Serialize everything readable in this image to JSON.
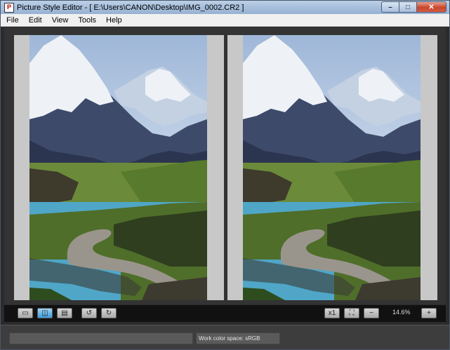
{
  "window": {
    "title": "Picture Style Editor - [ E:\\Users\\CANON\\Desktop\\IMG_0002.CR2 ]",
    "app_icon_glyph": "P",
    "controls": {
      "minimize": "–",
      "maximize": "□",
      "close": "✕"
    }
  },
  "menu": {
    "items": [
      {
        "label": "File"
      },
      {
        "label": "Edit"
      },
      {
        "label": "View"
      },
      {
        "label": "Tools"
      },
      {
        "label": "Help"
      }
    ]
  },
  "toolbar": {
    "left_buttons": [
      {
        "icon": "single-view-icon",
        "glyph": "▭",
        "active": false
      },
      {
        "icon": "split-view-icon",
        "glyph": "◫",
        "active": true
      },
      {
        "icon": "horizontal-split-icon",
        "glyph": "▤",
        "active": false
      },
      {
        "icon": "rotate-left-icon",
        "glyph": "↺",
        "active": false
      },
      {
        "icon": "rotate-right-icon",
        "glyph": "↻",
        "active": false
      }
    ],
    "right_buttons": [
      {
        "icon": "actual-size-icon",
        "glyph": "x1"
      },
      {
        "icon": "fit-to-window-icon",
        "glyph": "⛶"
      },
      {
        "icon": "zoom-out-icon",
        "glyph": "−"
      },
      {
        "icon": "zoom-in-icon",
        "glyph": "+"
      }
    ],
    "zoom_level": "14.6%"
  },
  "status": {
    "left_text": "",
    "color_space": "Work color space: sRGB"
  },
  "colors": {
    "sky": "#b9cde5",
    "snow": "#eef2f7",
    "rock": "#3d4a6a",
    "grass": "#6b8a3a",
    "water": "#4fa6c7",
    "road": "#9a958c"
  }
}
